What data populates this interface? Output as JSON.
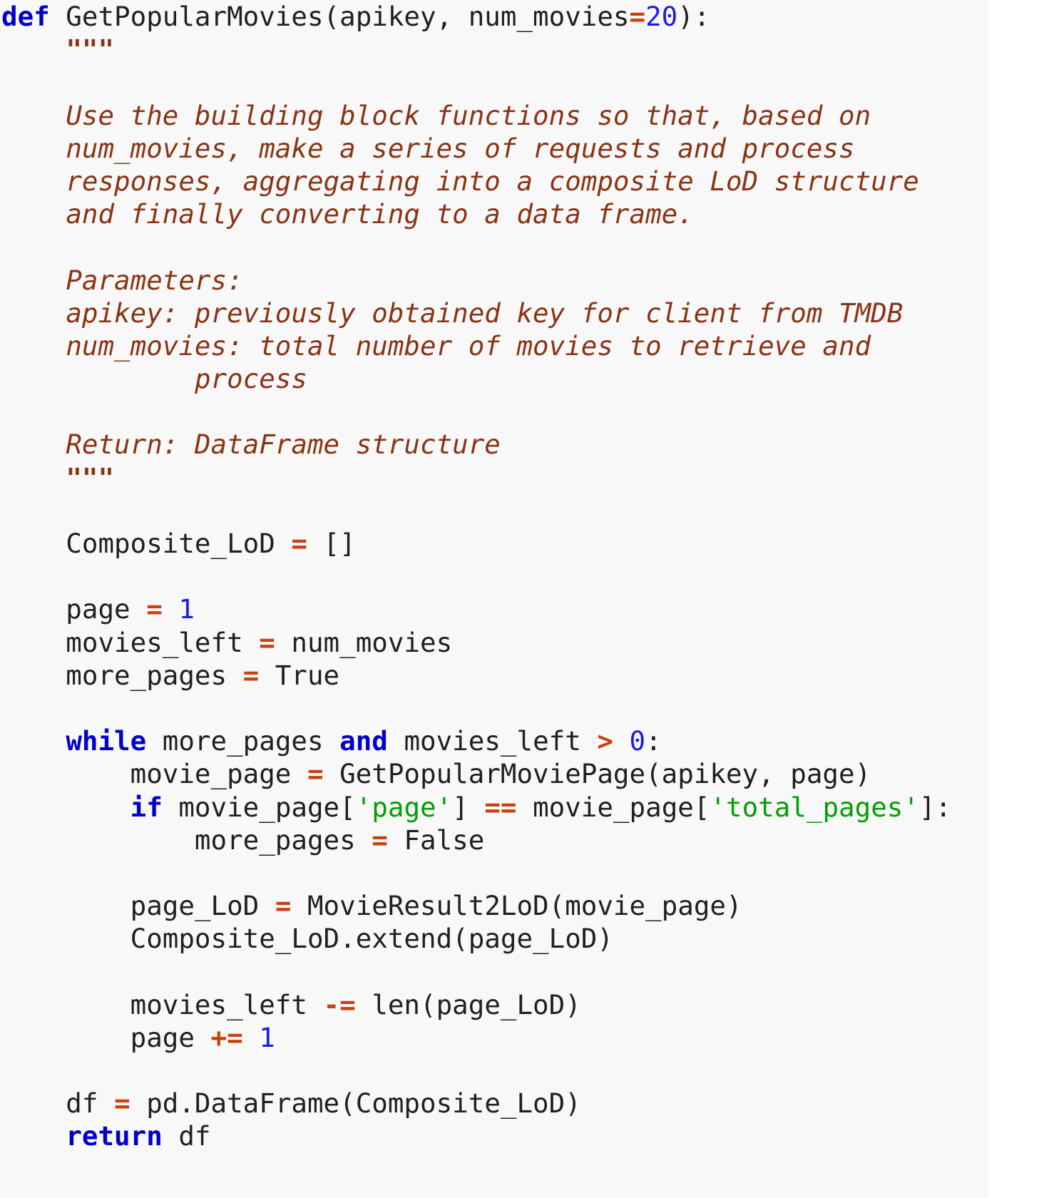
{
  "document": {
    "kind": "python-source-listing",
    "language": "Python",
    "function_name": "GetPopularMovies",
    "background_color": "#f8f8f8",
    "page_color": "#ffffff"
  },
  "palette": {
    "keyword": "#0000cc",
    "operator": "#c8410f",
    "number": "#1a1aee",
    "string": "#00a000",
    "docstring": "#8a3415",
    "plain": "#202020"
  },
  "code": {
    "lines": [
      {
        "id": "line-def",
        "tokens": [
          {
            "t": "kw",
            "v": "def"
          },
          {
            "t": "pl",
            "v": " GetPopularMovies(apikey, num_movies"
          },
          {
            "t": "op",
            "v": "="
          },
          {
            "t": "num",
            "v": "20"
          },
          {
            "t": "pl",
            "v": "):"
          }
        ]
      },
      {
        "id": "line-docstring-open",
        "tokens": [
          {
            "t": "pl",
            "v": "    "
          },
          {
            "t": "docq",
            "v": "\"\"\""
          }
        ]
      },
      {
        "id": "line-blank-1",
        "tokens": [
          {
            "t": "pl",
            "v": ""
          }
        ]
      },
      {
        "id": "line-doc-1",
        "tokens": [
          {
            "t": "pl",
            "v": "    "
          },
          {
            "t": "doc",
            "v": "Use the building block functions so that, based on"
          }
        ]
      },
      {
        "id": "line-doc-2",
        "tokens": [
          {
            "t": "pl",
            "v": "    "
          },
          {
            "t": "doc",
            "v": "num_movies, make a series of requests and process"
          }
        ]
      },
      {
        "id": "line-doc-3",
        "tokens": [
          {
            "t": "pl",
            "v": "    "
          },
          {
            "t": "doc",
            "v": "responses, aggregating into a composite LoD structure"
          }
        ]
      },
      {
        "id": "line-doc-4",
        "tokens": [
          {
            "t": "pl",
            "v": "    "
          },
          {
            "t": "doc",
            "v": "and finally converting to a data frame."
          }
        ]
      },
      {
        "id": "line-blank-2",
        "tokens": [
          {
            "t": "pl",
            "v": ""
          }
        ]
      },
      {
        "id": "line-doc-params",
        "tokens": [
          {
            "t": "pl",
            "v": "    "
          },
          {
            "t": "doc",
            "v": "Parameters:"
          }
        ]
      },
      {
        "id": "line-doc-apikey",
        "tokens": [
          {
            "t": "pl",
            "v": "    "
          },
          {
            "t": "doc",
            "v": "apikey: previously obtained key for client from TMDB"
          }
        ]
      },
      {
        "id": "line-doc-nummovies",
        "tokens": [
          {
            "t": "pl",
            "v": "    "
          },
          {
            "t": "doc",
            "v": "num_movies: total number of movies to retrieve and"
          }
        ]
      },
      {
        "id": "line-doc-process",
        "tokens": [
          {
            "t": "pl",
            "v": "            "
          },
          {
            "t": "doc",
            "v": "process"
          }
        ]
      },
      {
        "id": "line-blank-3",
        "tokens": [
          {
            "t": "pl",
            "v": ""
          }
        ]
      },
      {
        "id": "line-doc-return",
        "tokens": [
          {
            "t": "pl",
            "v": "    "
          },
          {
            "t": "doc",
            "v": "Return: DataFrame structure"
          }
        ]
      },
      {
        "id": "line-docstring-close",
        "tokens": [
          {
            "t": "pl",
            "v": "    "
          },
          {
            "t": "docq",
            "v": "\"\"\""
          }
        ]
      },
      {
        "id": "line-blank-4",
        "tokens": [
          {
            "t": "pl",
            "v": ""
          }
        ]
      },
      {
        "id": "line-composite-init",
        "tokens": [
          {
            "t": "pl",
            "v": "    Composite_LoD "
          },
          {
            "t": "op",
            "v": "="
          },
          {
            "t": "pl",
            "v": " []"
          }
        ]
      },
      {
        "id": "line-blank-5",
        "tokens": [
          {
            "t": "pl",
            "v": ""
          }
        ]
      },
      {
        "id": "line-page-init",
        "tokens": [
          {
            "t": "pl",
            "v": "    page "
          },
          {
            "t": "op",
            "v": "="
          },
          {
            "t": "pl",
            "v": " "
          },
          {
            "t": "num",
            "v": "1"
          }
        ]
      },
      {
        "id": "line-moviesleft-init",
        "tokens": [
          {
            "t": "pl",
            "v": "    movies_left "
          },
          {
            "t": "op",
            "v": "="
          },
          {
            "t": "pl",
            "v": " num_movies"
          }
        ]
      },
      {
        "id": "line-morepages-init",
        "tokens": [
          {
            "t": "pl",
            "v": "    more_pages "
          },
          {
            "t": "op",
            "v": "="
          },
          {
            "t": "pl",
            "v": " True"
          }
        ]
      },
      {
        "id": "line-blank-6",
        "tokens": [
          {
            "t": "pl",
            "v": ""
          }
        ]
      },
      {
        "id": "line-while",
        "tokens": [
          {
            "t": "pl",
            "v": "    "
          },
          {
            "t": "kw",
            "v": "while"
          },
          {
            "t": "pl",
            "v": " more_pages "
          },
          {
            "t": "kw",
            "v": "and"
          },
          {
            "t": "pl",
            "v": " movies_left "
          },
          {
            "t": "op",
            "v": ">"
          },
          {
            "t": "pl",
            "v": " "
          },
          {
            "t": "num",
            "v": "0"
          },
          {
            "t": "pl",
            "v": ":"
          }
        ]
      },
      {
        "id": "line-moviepage-assign",
        "tokens": [
          {
            "t": "pl",
            "v": "        movie_page "
          },
          {
            "t": "op",
            "v": "="
          },
          {
            "t": "pl",
            "v": " GetPopularMoviePage(apikey, page)"
          }
        ]
      },
      {
        "id": "line-if-lastpage",
        "tokens": [
          {
            "t": "pl",
            "v": "        "
          },
          {
            "t": "kw",
            "v": "if"
          },
          {
            "t": "pl",
            "v": " movie_page["
          },
          {
            "t": "str",
            "v": "'page'"
          },
          {
            "t": "pl",
            "v": "] "
          },
          {
            "t": "op",
            "v": "=="
          },
          {
            "t": "pl",
            "v": " movie_page["
          },
          {
            "t": "str",
            "v": "'total_pages'"
          },
          {
            "t": "pl",
            "v": "]:"
          }
        ]
      },
      {
        "id": "line-morepages-false",
        "tokens": [
          {
            "t": "pl",
            "v": "            more_pages "
          },
          {
            "t": "op",
            "v": "="
          },
          {
            "t": "pl",
            "v": " False"
          }
        ]
      },
      {
        "id": "line-blank-7",
        "tokens": [
          {
            "t": "pl",
            "v": ""
          }
        ]
      },
      {
        "id": "line-pagelod-assign",
        "tokens": [
          {
            "t": "pl",
            "v": "        page_LoD "
          },
          {
            "t": "op",
            "v": "="
          },
          {
            "t": "pl",
            "v": " MovieResult2LoD(movie_page)"
          }
        ]
      },
      {
        "id": "line-composite-extend",
        "tokens": [
          {
            "t": "pl",
            "v": "        Composite_LoD.extend(page_LoD)"
          }
        ]
      },
      {
        "id": "line-blank-8",
        "tokens": [
          {
            "t": "pl",
            "v": ""
          }
        ]
      },
      {
        "id": "line-moviesleft-decrement",
        "tokens": [
          {
            "t": "pl",
            "v": "        movies_left "
          },
          {
            "t": "op",
            "v": "-="
          },
          {
            "t": "pl",
            "v": " len(page_LoD)"
          }
        ]
      },
      {
        "id": "line-page-increment",
        "tokens": [
          {
            "t": "pl",
            "v": "        page "
          },
          {
            "t": "op",
            "v": "+="
          },
          {
            "t": "pl",
            "v": " "
          },
          {
            "t": "num",
            "v": "1"
          }
        ]
      },
      {
        "id": "line-blank-9",
        "tokens": [
          {
            "t": "pl",
            "v": ""
          }
        ]
      },
      {
        "id": "line-df-assign",
        "tokens": [
          {
            "t": "pl",
            "v": "    df "
          },
          {
            "t": "op",
            "v": "="
          },
          {
            "t": "pl",
            "v": " pd.DataFrame(Composite_LoD)"
          }
        ]
      },
      {
        "id": "line-return",
        "tokens": [
          {
            "t": "pl",
            "v": "    "
          },
          {
            "t": "kw",
            "v": "return"
          },
          {
            "t": "pl",
            "v": " df"
          }
        ]
      }
    ]
  }
}
